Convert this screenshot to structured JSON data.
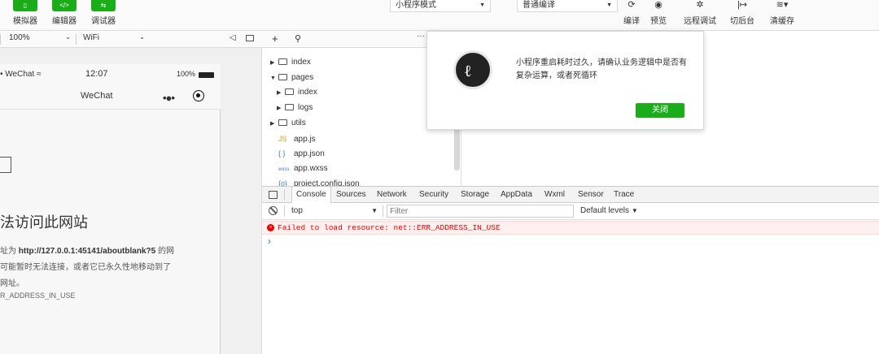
{
  "toolbar": {
    "simulator_label": "模拟器",
    "editor_label": "编辑器",
    "debugger_label": "调试器",
    "mode_select": "小程序模式",
    "compile_select": "普通编译",
    "compile_label": "编译",
    "preview_label": "预览",
    "remote_debug_label": "远程调试",
    "background_label": "切后台",
    "clear_cache_label": "清缓存"
  },
  "simbar": {
    "zoom": "100%",
    "network": "WiFi"
  },
  "phone": {
    "carrier": "WeChat",
    "time": "12:07",
    "battery": "100%",
    "nav_title": "WeChat",
    "error_title": "法访问此网站",
    "error_body_1_prefix": "址为 ",
    "error_body_1_url": "http://127.0.0.1:45141/aboutblank?5",
    "error_body_1_suffix": " 的网",
    "error_body_2": "可能暂时无法连接，或者它已永久性地移动到了",
    "error_body_3": "网址。",
    "error_code": "R_ADDRESS_IN_USE"
  },
  "filetree": {
    "items": [
      {
        "name": "index",
        "kind": "folder",
        "arrow": "▶"
      },
      {
        "name": "pages",
        "kind": "folder",
        "arrow": "▼"
      },
      {
        "name": "index",
        "kind": "folder",
        "arrow": "▶"
      },
      {
        "name": "logs",
        "kind": "folder",
        "arrow": "▶"
      },
      {
        "name": "utils",
        "kind": "folder",
        "arrow": "▶"
      },
      {
        "name": "app.js",
        "kind": "js",
        "badge": "JS"
      },
      {
        "name": "app.json",
        "kind": "json",
        "badge": "{ }"
      },
      {
        "name": "app.wxss",
        "kind": "wxss",
        "badge": "wxss"
      },
      {
        "name": "project.config.json",
        "kind": "json",
        "badge": "{o}"
      }
    ]
  },
  "devtools": {
    "tabs": [
      "Console",
      "Sources",
      "Network",
      "Security",
      "Storage",
      "AppData",
      "Wxml",
      "Sensor",
      "Trace"
    ],
    "context": "top",
    "filter_placeholder": "Filter",
    "levels": "Default levels",
    "error_message": "Failed to load resource: net::ERR_ADDRESS_IN_USE",
    "prompt": "›"
  },
  "dialog": {
    "message": "小程序重启耗时过久，请确认业务逻辑中是否有复杂运算，或者死循环",
    "close_label": "关闭"
  },
  "colors": {
    "accent": "#1aad19",
    "error": "#e00000",
    "error_bg": "#fff0f0"
  }
}
